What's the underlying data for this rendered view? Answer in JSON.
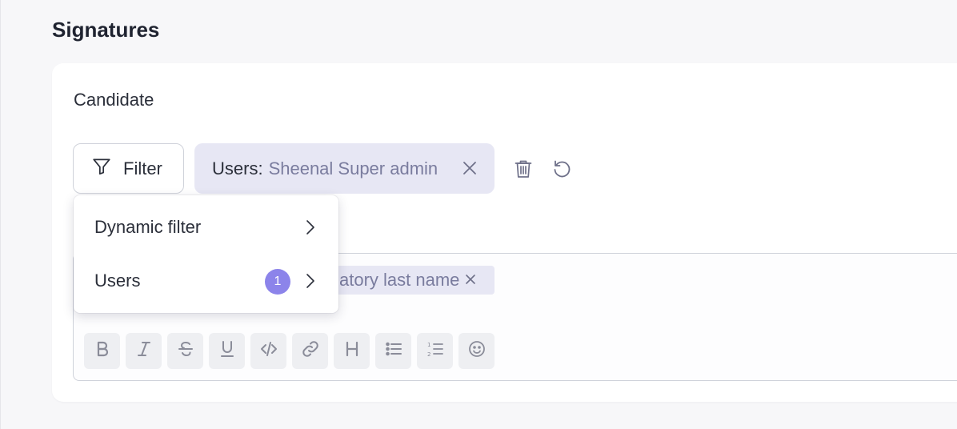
{
  "section": {
    "title": "Signatures"
  },
  "card": {
    "label": "Candidate"
  },
  "filter": {
    "button_label": "Filter"
  },
  "active_chip": {
    "key": "Users:",
    "value": "Sheenal Super admin"
  },
  "editor": {
    "variable_chip": "atory last name"
  },
  "dropdown": {
    "items": [
      {
        "label": "Dynamic filter"
      },
      {
        "label": "Users",
        "badge": "1"
      }
    ]
  },
  "colors": {
    "accent": "#8c84ea",
    "chip_bg": "#e7e7f4",
    "chip_value": "#7a7c9e"
  },
  "toolbar_icons": [
    "bold-icon",
    "italic-icon",
    "strikethrough-icon",
    "underline-icon",
    "code-icon",
    "link-icon",
    "heading-icon",
    "bullet-list-icon",
    "numbered-list-icon",
    "emoji-icon"
  ]
}
